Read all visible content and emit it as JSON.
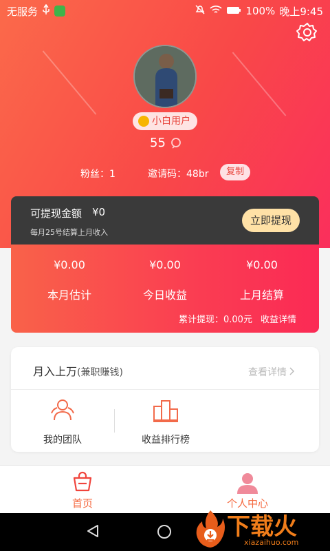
{
  "status_bar": {
    "carrier": "无服务",
    "battery": "100%",
    "time": "晚上9:45"
  },
  "profile": {
    "badge": "小白用户",
    "score": "55",
    "fans_label": "粉丝：1",
    "invite_label": "邀请码：48br",
    "copy_button": "复制"
  },
  "withdraw": {
    "title": "可提现金额",
    "amount": "¥0",
    "note": "每月25号结算上月收入",
    "button": "立即提现"
  },
  "income": {
    "columns": [
      {
        "value": "¥0.00",
        "label": "本月估计"
      },
      {
        "value": "¥0.00",
        "label": "今日收益"
      },
      {
        "value": "¥0.00",
        "label": "上月结算"
      }
    ],
    "total": "累计提现：0.00元",
    "detail": "收益详情"
  },
  "panel": {
    "title": "月入上万",
    "subtitle": "(兼职赚钱)",
    "more": "查看详情",
    "tools": [
      {
        "label": "我的团队"
      },
      {
        "label": "收益排行榜"
      }
    ]
  },
  "tabs": [
    {
      "label": "首页",
      "active": false
    },
    {
      "label": "个人中心",
      "active": true
    }
  ],
  "watermark": {
    "text": "下载火",
    "url": "xiazaihuo.com"
  },
  "colors": {
    "primary": "#f94848",
    "accent": "#f56a40",
    "dark_card": "#3a3a3a",
    "withdraw_btn": "#ffe1a6",
    "watermark": "#f07d1a"
  },
  "icons": [
    "usb-icon",
    "leaf-icon",
    "mute-icon",
    "wifi-icon",
    "battery-icon",
    "gear-icon",
    "star-icon",
    "chat-icon",
    "team-icon",
    "ranking-icon",
    "cart-icon",
    "person-icon",
    "back-icon",
    "home-icon"
  ]
}
